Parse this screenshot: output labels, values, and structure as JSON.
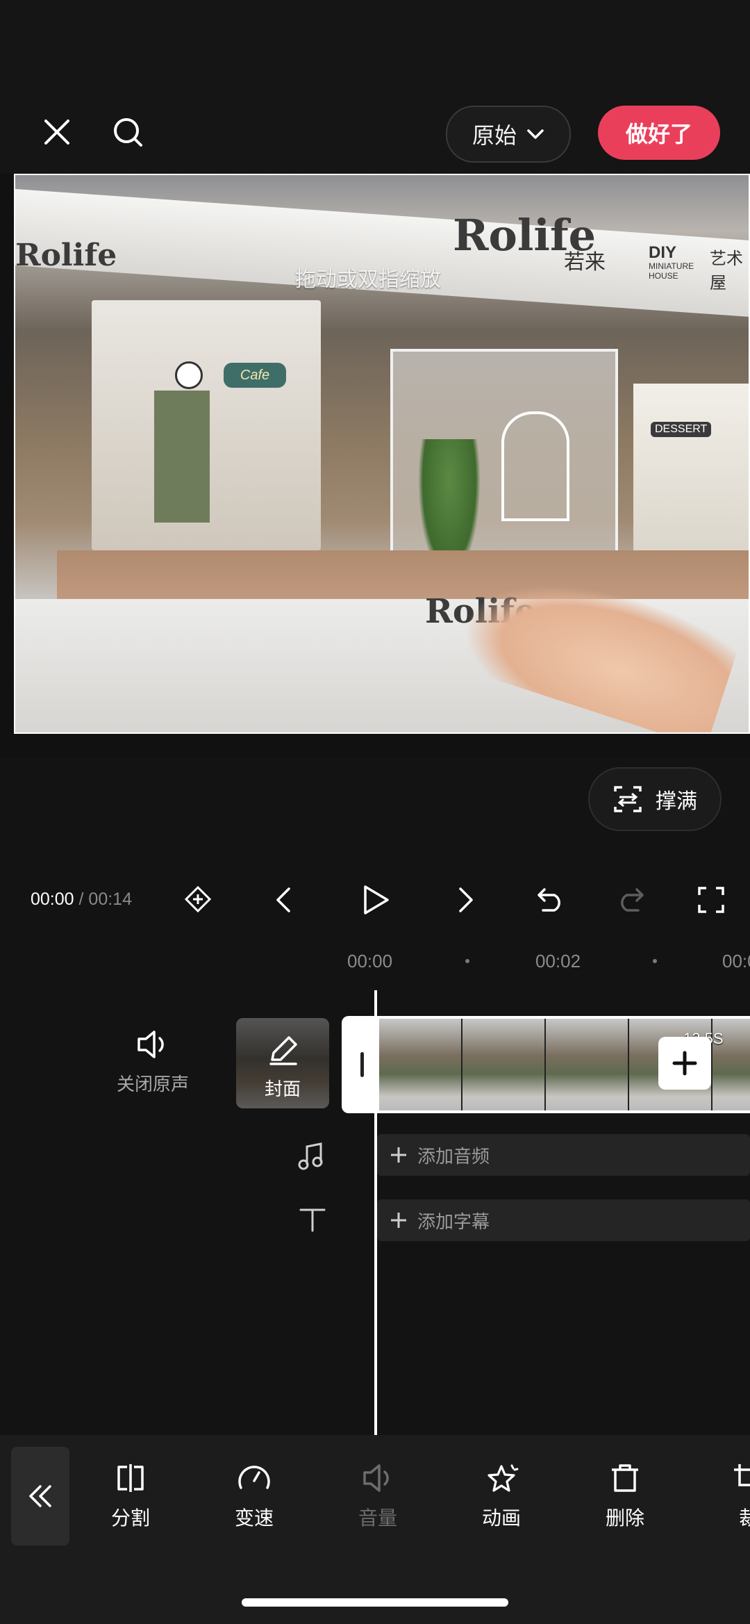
{
  "header": {
    "ratio_label": "原始",
    "done_label": "做好了"
  },
  "preview": {
    "hint": "拖动或双指缩放",
    "banner_brand": "Rolife",
    "banner_cn": "若来",
    "banner_diy": "DIY",
    "banner_mini": "MINIATURE HOUSE",
    "banner_art": "艺术屋",
    "sign_cafe": "Cafe",
    "sign_dessert": "DESSERT"
  },
  "fill_button": {
    "label": "撑满"
  },
  "playback": {
    "current": "00:00",
    "separator": "/",
    "total": "00:14"
  },
  "timeline": {
    "ruler": [
      "00:00",
      "00:02",
      "00:0"
    ],
    "mute_label": "关闭原声",
    "cover_label": "封面",
    "clip_duration": "13.5S",
    "add_audio": "添加音频",
    "add_caption": "添加字幕"
  },
  "toolbar": {
    "items": [
      {
        "label": "分割",
        "icon": "split-icon",
        "enabled": true
      },
      {
        "label": "变速",
        "icon": "speed-icon",
        "enabled": true
      },
      {
        "label": "音量",
        "icon": "volume-icon",
        "enabled": false
      },
      {
        "label": "动画",
        "icon": "animation-icon",
        "enabled": true
      },
      {
        "label": "删除",
        "icon": "delete-icon",
        "enabled": true
      },
      {
        "label": "裁",
        "icon": "crop-icon",
        "enabled": true
      }
    ]
  },
  "colors": {
    "accent": "#ea3f5b",
    "background": "#131313"
  }
}
